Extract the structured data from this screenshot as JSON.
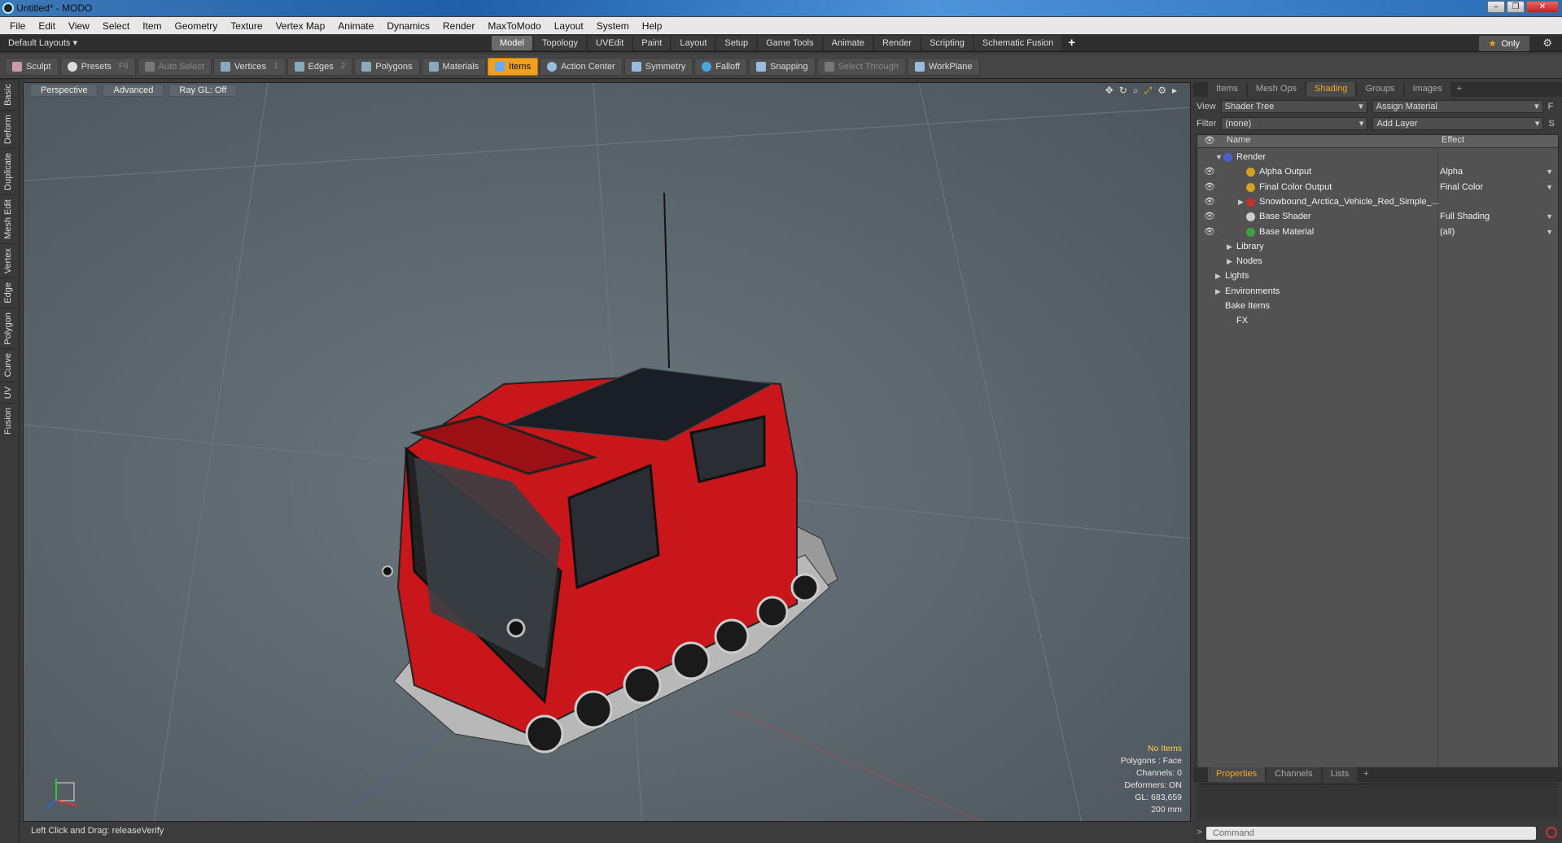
{
  "window": {
    "title": "Untitled* - MODO",
    "minimize": "–",
    "maximize": "❐",
    "close": "✕"
  },
  "menu": [
    "File",
    "Edit",
    "View",
    "Select",
    "Item",
    "Geometry",
    "Texture",
    "Vertex Map",
    "Animate",
    "Dynamics",
    "Render",
    "MaxToModo",
    "Layout",
    "System",
    "Help"
  ],
  "layoutbar": {
    "layout_selector": "Default Layouts ▾",
    "tabs": [
      "Model",
      "Topology",
      "UVEdit",
      "Paint",
      "Layout",
      "Setup",
      "Game Tools",
      "Animate",
      "Render",
      "Scripting",
      "Schematic Fusion"
    ],
    "active_tab": "Model",
    "add": "+",
    "only": "Only"
  },
  "toolbar": {
    "sculpt": "Sculpt",
    "presets": "Presets",
    "presets_key": "F6",
    "auto_select": "Auto Select",
    "vertices": "Vertices",
    "vertices_key": "1",
    "edges": "Edges",
    "edges_key": "2",
    "polygons": "Polygons",
    "materials": "Materials",
    "items": "Items",
    "action_center": "Action Center",
    "symmetry": "Symmetry",
    "falloff": "Falloff",
    "snapping": "Snapping",
    "select_through": "Select Through",
    "workplane": "WorkPlane"
  },
  "left_tabs": [
    "Basic",
    "Deform",
    "Duplicate",
    "Mesh Edit",
    "Vertex",
    "Edge",
    "Polygon",
    "Curve",
    "UV",
    "Fusion"
  ],
  "viewport": {
    "view": "Perspective",
    "shading": "Advanced",
    "raygl": "Ray GL: Off",
    "info": {
      "items": "No Items",
      "polygons": "Polygons : Face",
      "channels": "Channels: 0",
      "deformers": "Deformers: ON",
      "gl": "GL: 683,659",
      "grid": "200 mm"
    }
  },
  "status": "Left Click and Drag:  releaseVerify",
  "right_panel": {
    "tabs": [
      "Items",
      "Mesh Ops",
      "Shading",
      "Groups",
      "Images"
    ],
    "active_tab": "Shading",
    "add": "+",
    "view_label": "View",
    "view_value": "Shader Tree",
    "assign_material": "Assign Material",
    "f_btn": "F",
    "filter_label": "Filter",
    "filter_value": "(none)",
    "add_layer": "Add Layer",
    "s_btn": "S",
    "col_name": "Name",
    "col_effect": "Effect",
    "tree": [
      {
        "label": "Render",
        "effect": "",
        "indent": 0,
        "eye": false,
        "color": "#4a5fd0",
        "expander": "▼"
      },
      {
        "label": "Alpha Output",
        "effect": "Alpha",
        "indent": 2,
        "eye": true,
        "color": "#d8a020",
        "expander": ""
      },
      {
        "label": "Final Color Output",
        "effect": "Final Color",
        "indent": 2,
        "eye": true,
        "color": "#d8a020",
        "expander": ""
      },
      {
        "label": "Snowbound_Arctica_Vehicle_Red_Simple_...",
        "effect": "",
        "indent": 2,
        "eye": true,
        "color": "#c03030",
        "expander": "▶"
      },
      {
        "label": "Base Shader",
        "effect": "Full Shading",
        "indent": 2,
        "eye": true,
        "color": "#cccccc",
        "expander": ""
      },
      {
        "label": "Base Material",
        "effect": "(all)",
        "indent": 2,
        "eye": true,
        "color": "#40a040",
        "expander": ""
      },
      {
        "label": "Library",
        "effect": "",
        "indent": 1,
        "eye": false,
        "color": "",
        "expander": "▶"
      },
      {
        "label": "Nodes",
        "effect": "",
        "indent": 1,
        "eye": false,
        "color": "",
        "expander": "▶"
      },
      {
        "label": "Lights",
        "effect": "",
        "indent": 0,
        "eye": false,
        "color": "",
        "expander": "▶"
      },
      {
        "label": "Environments",
        "effect": "",
        "indent": 0,
        "eye": false,
        "color": "",
        "expander": "▶"
      },
      {
        "label": "Bake Items",
        "effect": "",
        "indent": 0,
        "eye": false,
        "color": "",
        "expander": ""
      },
      {
        "label": "FX",
        "effect": "",
        "indent": 1,
        "eye": false,
        "color": "",
        "expander": ""
      }
    ],
    "bottom_tabs": [
      "Properties",
      "Channels",
      "Lists"
    ],
    "bottom_active": "Properties",
    "command_placeholder": "Command"
  }
}
